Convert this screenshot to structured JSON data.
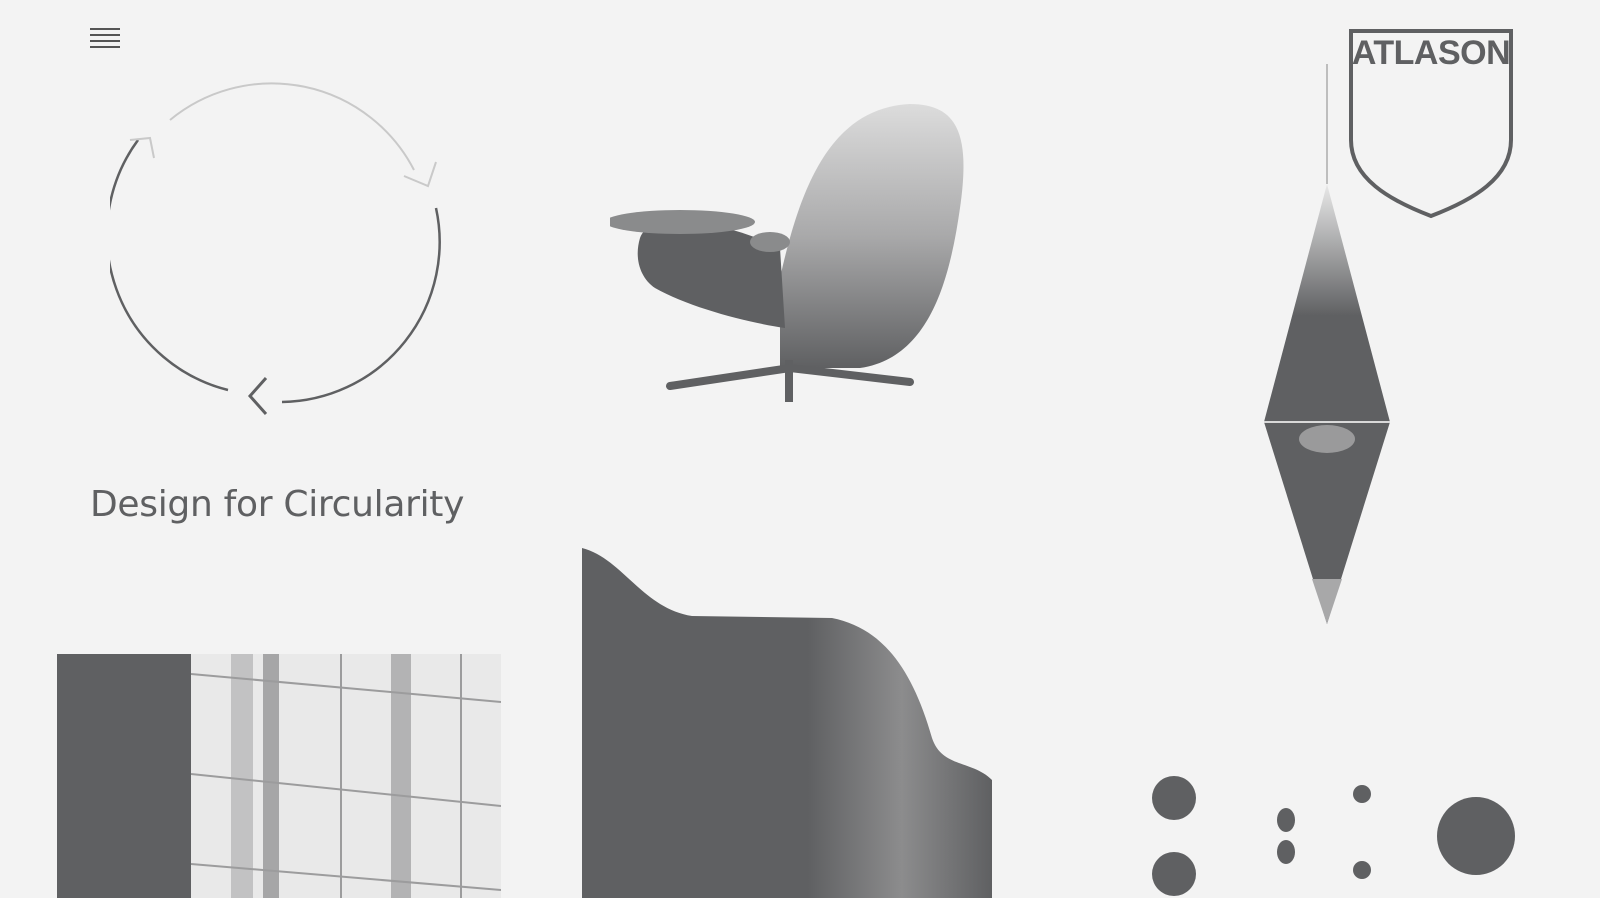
{
  "header": {
    "menu_icon": "hamburger-menu-icon",
    "logo_text": "ATLASON"
  },
  "hero": {
    "headline": "Design for Circularity"
  },
  "colors": {
    "background": "#f3f3f3",
    "ink": "#5f6062",
    "ink_light": "#c9c9c9"
  },
  "icons": {
    "cycle": "circular-arrows-icon",
    "dots": "dot-pattern-icon"
  }
}
